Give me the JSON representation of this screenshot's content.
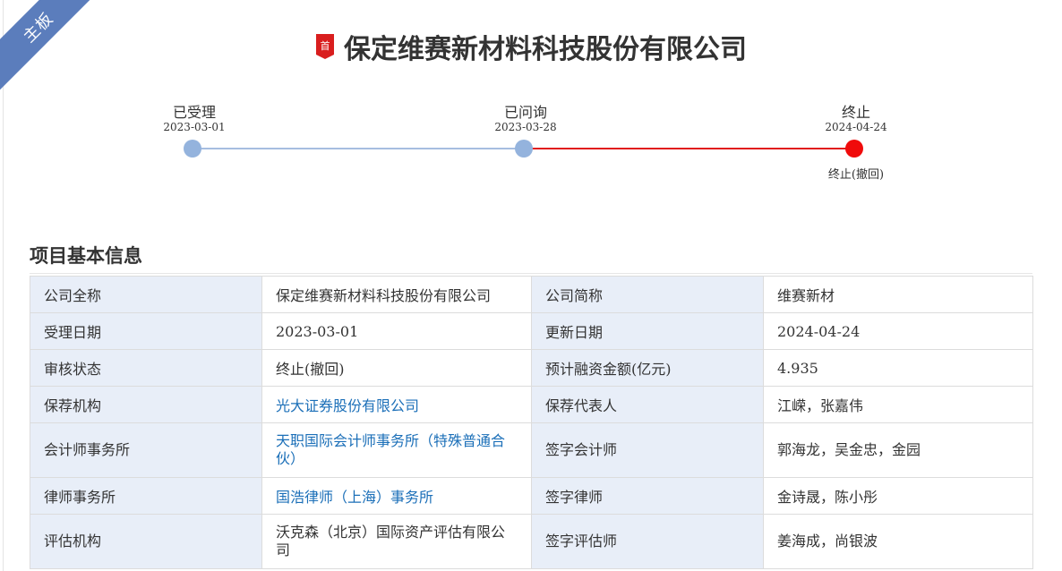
{
  "board_tag": "主板",
  "company_title": "保定维赛新材料科技股份有限公司",
  "badge_char": "首",
  "colors": {
    "accent_blue": "#5b7dbc",
    "stop_red": "#e11b1b",
    "link": "#1b6fb8",
    "label_bg": "#e8eef8"
  },
  "timeline": {
    "steps": [
      {
        "label": "已受理",
        "date": "2023-03-01",
        "status": "done",
        "note": ""
      },
      {
        "label": "已问询",
        "date": "2023-03-28",
        "status": "done",
        "note": ""
      },
      {
        "label": "终止",
        "date": "2024-04-24",
        "status": "terminated",
        "note": "终止(撤回)"
      }
    ]
  },
  "section_title": "项目基本信息",
  "info_rows": [
    {
      "l1": "公司全称",
      "v1": "保定维赛新材料科技股份有限公司",
      "l2": "公司简称",
      "v2": "维赛新材"
    },
    {
      "l1": "受理日期",
      "v1": "2023-03-01",
      "l2": "更新日期",
      "v2": "2024-04-24"
    },
    {
      "l1": "审核状态",
      "v1": "终止(撤回)",
      "l2": "预计融资金额(亿元)",
      "v2": "4.935"
    },
    {
      "l1": "保荐机构",
      "v1": "光大证券股份有限公司",
      "l2": "保荐代表人",
      "v2": "江嵘，张嘉伟"
    },
    {
      "l1": "会计师事务所",
      "v1": "天职国际会计师事务所（特殊普通合伙）",
      "l2": "签字会计师",
      "v2": "郭海龙，吴金忠，金园"
    },
    {
      "l1": "律师事务所",
      "v1": "国浩律师（上海）事务所",
      "l2": "签字律师",
      "v2": "金诗晟，陈小彤"
    },
    {
      "l1": "评估机构",
      "v1": "沃克森（北京）国际资产评估有限公司",
      "l2": "签字评估师",
      "v2": "姜海成，尚银波"
    }
  ]
}
